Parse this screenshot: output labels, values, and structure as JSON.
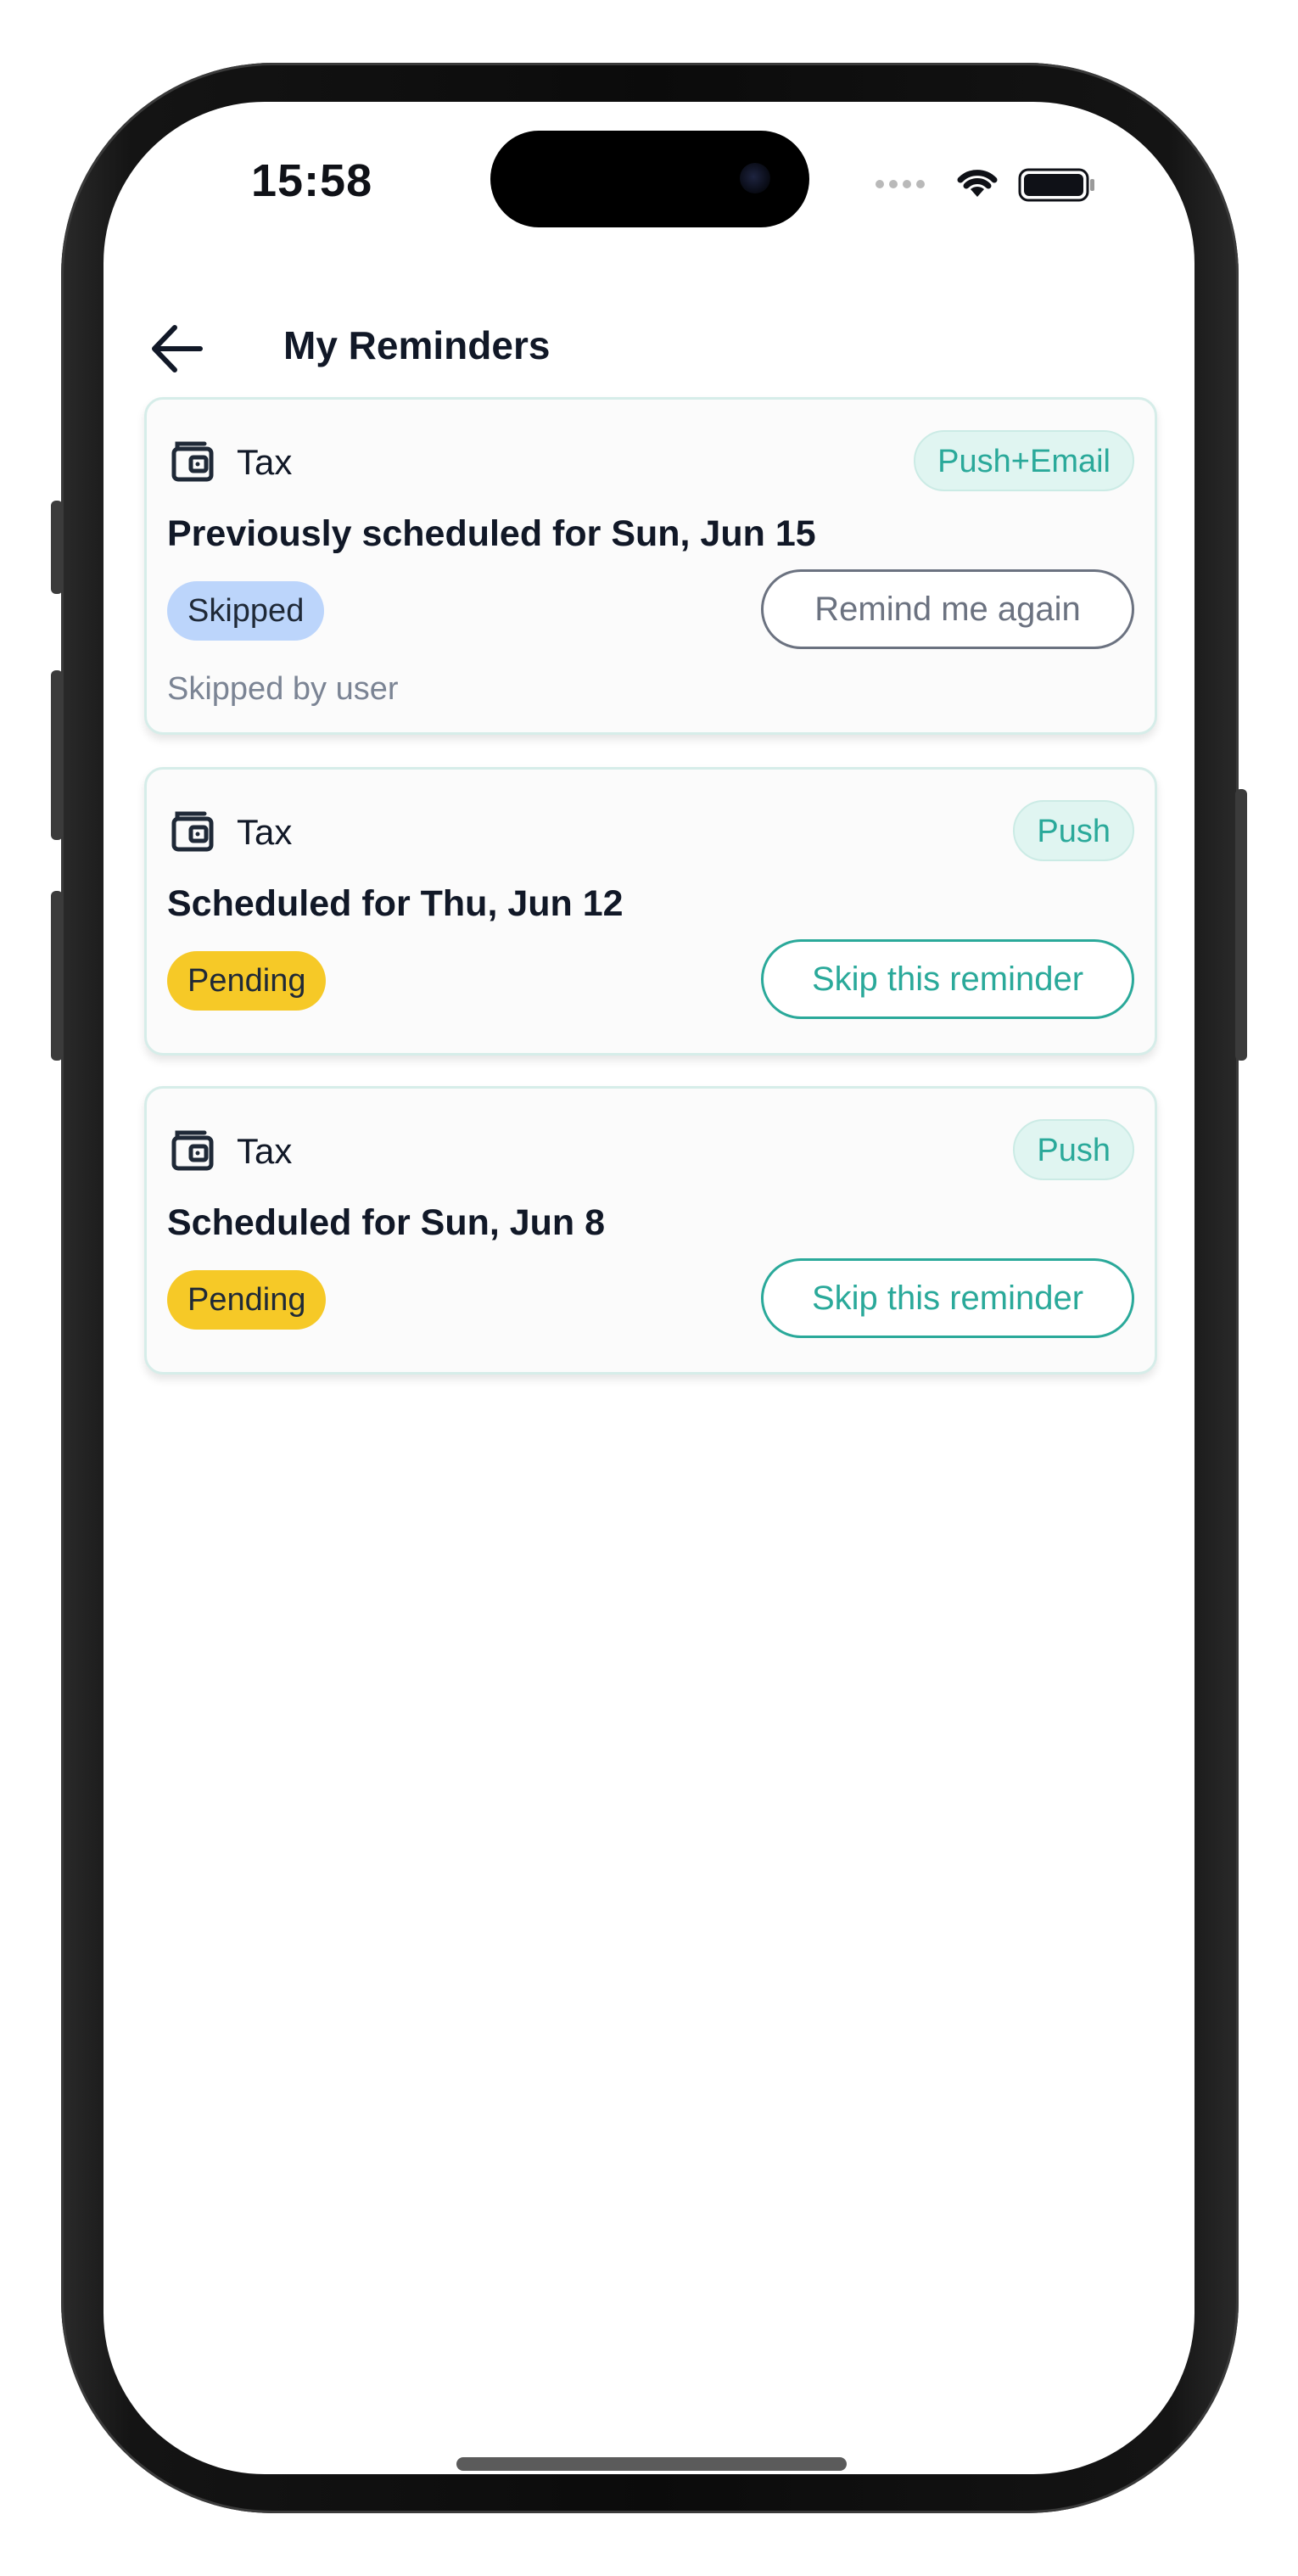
{
  "status_bar": {
    "time": "15:58",
    "icons": [
      "cellular-signal-icon",
      "wifi-icon",
      "battery-icon"
    ]
  },
  "header": {
    "title": "My Reminders",
    "back_icon": "arrow-left-icon"
  },
  "colors": {
    "accent_teal": "#2aa99a",
    "skipped_pill": "#bcd5fb",
    "pending_pill": "#f6c927",
    "text_dark": "#111827",
    "text_muted": "#7b8494"
  },
  "reminders": [
    {
      "category": "Tax",
      "category_icon": "wallet-icon",
      "channel": "Push+Email",
      "title": "Previously scheduled for Sun, Jun 15",
      "status": "Skipped",
      "action_label": "Remind me again",
      "note": "Skipped by user"
    },
    {
      "category": "Tax",
      "category_icon": "wallet-icon",
      "channel": "Push",
      "title": "Scheduled for Thu, Jun 12",
      "status": "Pending",
      "action_label": "Skip this reminder"
    },
    {
      "category": "Tax",
      "category_icon": "wallet-icon",
      "channel": "Push",
      "title": "Scheduled for Sun, Jun 8",
      "status": "Pending",
      "action_label": "Skip this reminder"
    }
  ]
}
